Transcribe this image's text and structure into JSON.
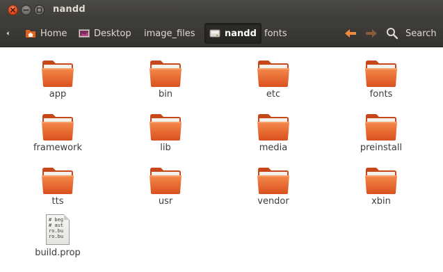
{
  "window": {
    "title": "nandd"
  },
  "toolbar": {
    "breadcrumbs": [
      {
        "label": "Home",
        "icon": "home-folder-icon"
      },
      {
        "label": "Desktop",
        "icon": "desktop-icon"
      },
      {
        "label": "image_files",
        "icon": ""
      },
      {
        "label": "nandd",
        "icon": "drive-icon",
        "active": true
      },
      {
        "label": "fonts",
        "icon": ""
      }
    ],
    "search_label": "Search",
    "back_icon": "back-arrow-icon",
    "forward_icon": "forward-arrow-icon"
  },
  "files": [
    {
      "name": "app",
      "type": "folder"
    },
    {
      "name": "bin",
      "type": "folder"
    },
    {
      "name": "etc",
      "type": "folder"
    },
    {
      "name": "fonts",
      "type": "folder"
    },
    {
      "name": "framework",
      "type": "folder"
    },
    {
      "name": "lib",
      "type": "folder"
    },
    {
      "name": "media",
      "type": "folder"
    },
    {
      "name": "preinstall",
      "type": "folder"
    },
    {
      "name": "tts",
      "type": "folder"
    },
    {
      "name": "usr",
      "type": "folder"
    },
    {
      "name": "vendor",
      "type": "folder"
    },
    {
      "name": "xbin",
      "type": "folder"
    },
    {
      "name": "build.prop",
      "type": "text-file",
      "preview": [
        "# beg",
        "# aut",
        "ro.bu",
        "ro.bu"
      ]
    }
  ],
  "colors": {
    "folder_orange": "#e95420",
    "close_button": "#e2491c",
    "titlebar": "#3d3c38"
  }
}
